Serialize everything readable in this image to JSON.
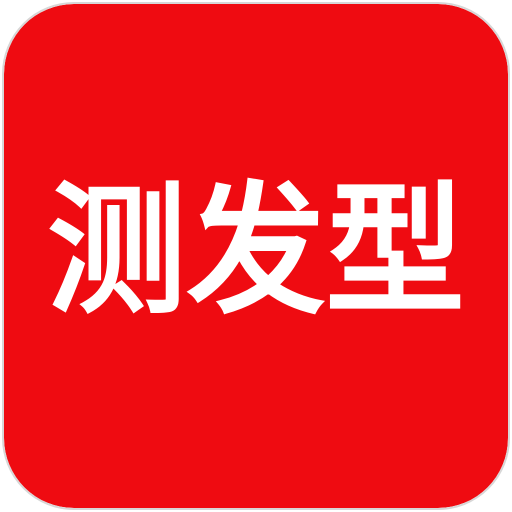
{
  "app_icon": {
    "label": "测发型",
    "background_color": "#EF0B11",
    "text_color": "#FFFFFF",
    "border_color": "#D7D7D7"
  }
}
